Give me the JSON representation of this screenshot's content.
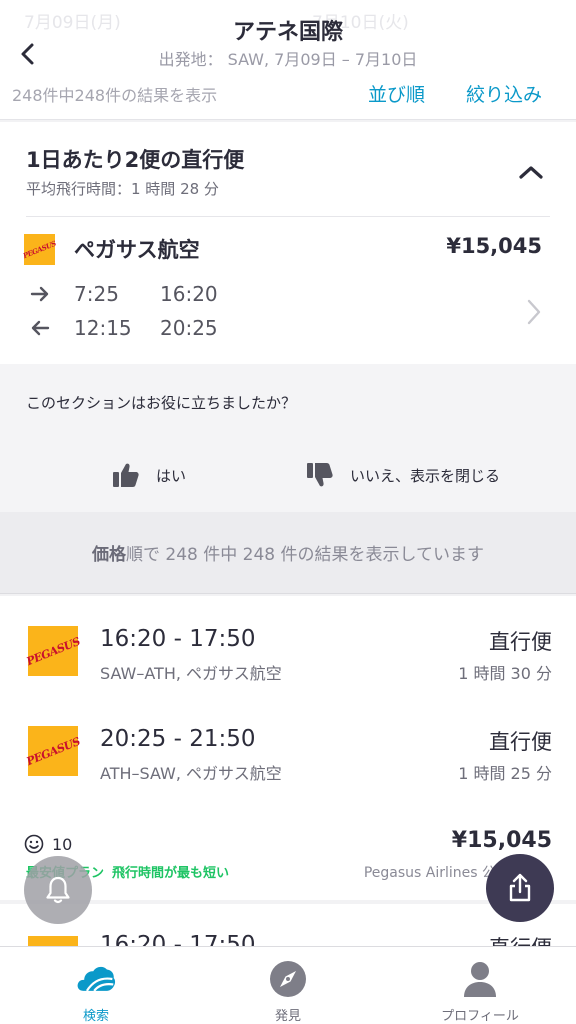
{
  "header": {
    "title": "アテネ国際",
    "subtitle": "出発地： SAW, 7月09日 – 7月10日",
    "ghost_left": "7月09日(月)",
    "ghost_right": "7月10日(火)",
    "result_count": "248件中248件の結果を表示",
    "sort_label": "並び順",
    "filter_label": "絞り込み"
  },
  "card": {
    "title": "1日あたり2便の直行便",
    "subtitle": "平均飛行時間：1 時間 28 分",
    "airline": "ペガサス航空",
    "price": "¥15,045",
    "outbound": {
      "dep": "7:25",
      "arr": "16:20"
    },
    "inbound": {
      "dep": "12:15",
      "arr": "20:25"
    }
  },
  "feedback": {
    "question": "このセクションはお役に立ちましたか？",
    "yes": "はい",
    "no": "いいえ、表示を閉じる"
  },
  "banner": {
    "bold": "価格",
    "rest": "順で 248 件中 248 件の結果を表示しています"
  },
  "logo_text": "PEGASUS",
  "result": {
    "legs": [
      {
        "time": "16:20 - 17:50",
        "route": "SAW–ATH, ペガサス航空",
        "type": "直行便",
        "duration": "1 時間 30 分"
      },
      {
        "time": "20:25 - 21:50",
        "route": "ATH–SAW, ペガサス航空",
        "type": "直行便",
        "duration": "1 時間 25 分"
      }
    ],
    "score": "10",
    "price": "¥15,045",
    "tag_cheapest": "最安値プラン",
    "tag_shortest": "飛行時間が最も短い",
    "provider": "Pegasus Airlines 公式サイト"
  },
  "result2": {
    "time": "16:20 - 17:50",
    "type": "直行便"
  },
  "tabs": [
    {
      "label": "検索"
    },
    {
      "label": "発見"
    },
    {
      "label": "プロフィール"
    }
  ],
  "colors": {
    "accent": "#0b99c9",
    "green": "#1ec464",
    "fab_dark": "#3e3a54",
    "logo_yellow": "#fbb41a",
    "logo_red": "#c8102e"
  }
}
